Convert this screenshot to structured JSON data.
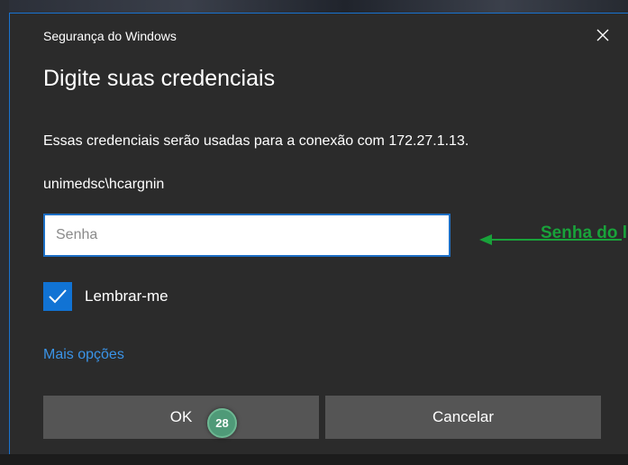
{
  "dialog": {
    "window_title": "Segurança do Windows",
    "heading": "Digite suas credenciais",
    "description": "Essas credenciais serão usadas para a conexão com 172.27.1.13.",
    "username": "unimedsc\\hcargnin",
    "password": {
      "value": "",
      "placeholder": "Senha"
    },
    "remember": {
      "label": "Lembrar-me",
      "checked": true
    },
    "more_options": "Mais opções",
    "ok_label": "OK",
    "cancel_label": "Cancelar",
    "close_icon": "close-icon"
  },
  "annotation": {
    "text": "Senha do l",
    "color": "#19a23a"
  },
  "badge": {
    "number": "28"
  },
  "colors": {
    "accent": "#1873d1",
    "link": "#3a94e8",
    "button": "#555555",
    "dialog_bg": "#2b2b2b"
  }
}
